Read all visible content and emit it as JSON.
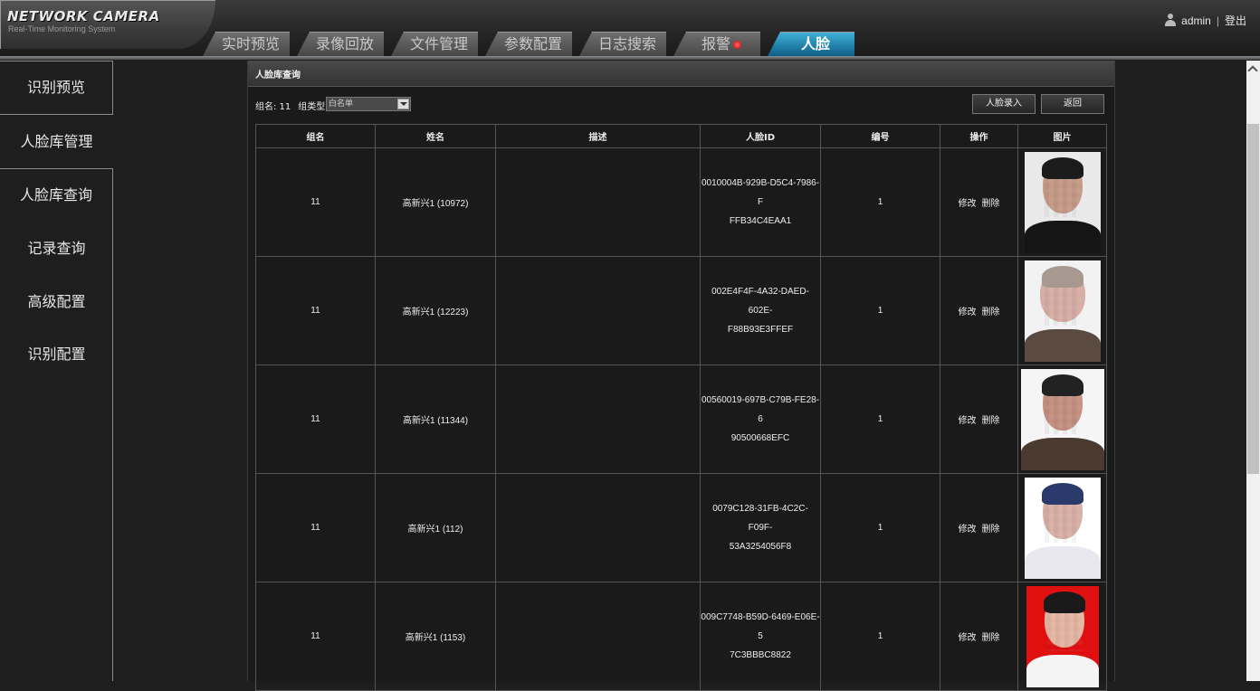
{
  "header": {
    "logo_title": "NETWORK CAMERA",
    "logo_subtitle": "Real-Time Monitoring System",
    "tabs": [
      {
        "label": "实时预览"
      },
      {
        "label": "录像回放"
      },
      {
        "label": "文件管理"
      },
      {
        "label": "参数配置"
      },
      {
        "label": "日志搜索"
      },
      {
        "label": "报警"
      },
      {
        "label": "人脸",
        "active": true
      }
    ],
    "user": "admin",
    "separator": "|",
    "logout": "登出"
  },
  "sidebar": {
    "items": [
      {
        "label": "识别预览"
      },
      {
        "label": "人脸库管理"
      },
      {
        "label": "人脸库查询"
      },
      {
        "label": "记录查询"
      },
      {
        "label": "高级配置"
      },
      {
        "label": "识别配置"
      }
    ]
  },
  "panel": {
    "title": "人脸库查询",
    "group_name_label": "组名: 11",
    "group_type_label": "组类型:",
    "group_type_value": "白名单",
    "add_button": "人脸录入",
    "back_button": "返回"
  },
  "table": {
    "headers": [
      "组名",
      "姓名",
      "描述",
      "人脸ID",
      "编号",
      "操作",
      "图片"
    ],
    "edit_label": "修改",
    "delete_label": "删除",
    "rows": [
      {
        "group": "11",
        "name": "高新兴1 (10972)",
        "desc": "",
        "id1": "0010004B-929B-D5C4-7986-F",
        "id2": "FFB34C4EAA1",
        "num": "1"
      },
      {
        "group": "11",
        "name": "高新兴1 (12223)",
        "desc": "",
        "id1": "002E4F4F-4A32-DAED-602E-",
        "id2": "F88B93E3FFEF",
        "num": "1"
      },
      {
        "group": "11",
        "name": "高新兴1 (11344)",
        "desc": "",
        "id1": "00560019-697B-C79B-FE28-6",
        "id2": "90500668EFC",
        "num": "1"
      },
      {
        "group": "11",
        "name": "高新兴1 (112)",
        "desc": "",
        "id1": "0079C128-31FB-4C2C-F09F-",
        "id2": "53A3254056F8",
        "num": "1"
      },
      {
        "group": "11",
        "name": "高新兴1 (1153)",
        "desc": "",
        "id1": "009C7748-B59D-6469-E06E-5",
        "id2": "7C3BBBC8822",
        "num": "1"
      }
    ]
  },
  "colors": {
    "active_tab": "#1b88b8",
    "photo_bg_red": "#e01010",
    "photo_bg_white": "#ffffff"
  }
}
